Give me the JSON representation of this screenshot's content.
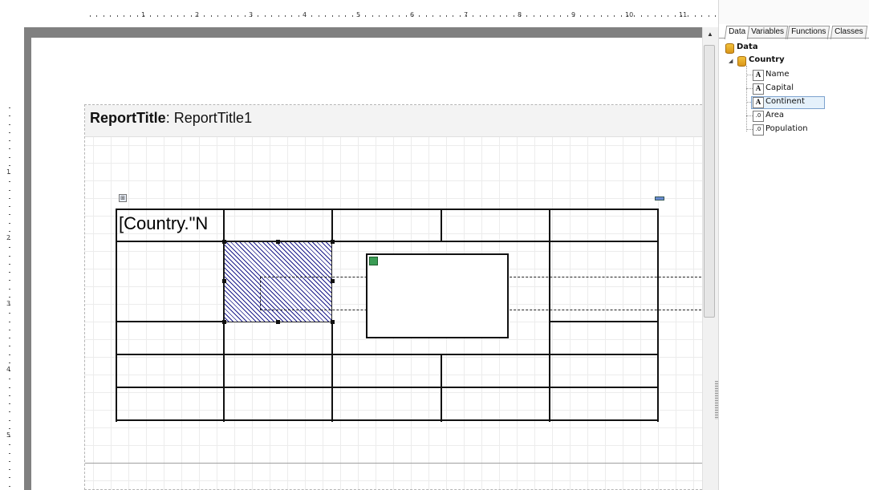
{
  "ruler": {
    "top_numbers": [
      "1",
      "2",
      "3",
      "4",
      "5",
      "6",
      "7",
      "8",
      "9",
      "10",
      "11"
    ],
    "left_numbers": [
      "1",
      "2",
      "3",
      "4",
      "5"
    ]
  },
  "band": {
    "type_label": "ReportTitle",
    "separator": ": ",
    "name": "ReportTitle1"
  },
  "table": {
    "first_cell_text": "[Country.\"N"
  },
  "panel": {
    "tabs": [
      "Data",
      "Variables",
      "Functions",
      "Classes"
    ],
    "active_tab": "Data",
    "tree": {
      "root_label": "Data",
      "datasource_label": "Country",
      "fields": [
        {
          "label": "Name",
          "icon": "text-field-icon",
          "glyph": "A"
        },
        {
          "label": "Capital",
          "icon": "text-field-icon",
          "glyph": "A"
        },
        {
          "label": "Continent",
          "icon": "text-field-icon",
          "glyph": "A",
          "selected": true
        },
        {
          "label": "Area",
          "icon": "numeric-field-icon",
          "glyph": ".0"
        },
        {
          "label": "Population",
          "icon": "numeric-field-icon",
          "glyph": ".0"
        }
      ]
    }
  },
  "colors": {
    "page_shadow": "#808080",
    "selection_blue": "#1a1a8a",
    "tree_selection": "#e5f1fb"
  }
}
